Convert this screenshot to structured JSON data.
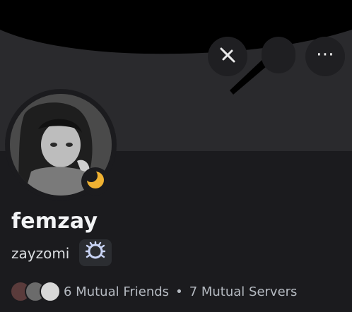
{
  "profile": {
    "display_name": "femzay",
    "username": "zayzomi",
    "status": "idle"
  },
  "header": {
    "buttons": [
      {
        "icon": "mute-icon"
      },
      {
        "icon": "more-icon",
        "label": "⋯"
      }
    ]
  },
  "mutual": {
    "friends": "6 Mutual Friends",
    "separator": "•",
    "servers": "7 Mutual Servers"
  },
  "colors": {
    "background": "#1b1b1e",
    "banner": "#2a2a2d",
    "idle": "#f0b232",
    "text_primary": "#f2f3f5",
    "text_muted": "#b5bac1"
  }
}
